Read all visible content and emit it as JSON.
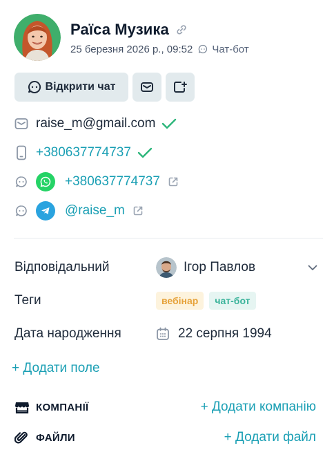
{
  "contact": {
    "name": "Раїса Музика",
    "created_at": "25 березня 2026 р., 09:52",
    "source": "Чат-бот"
  },
  "actions": {
    "open_chat_label": "Відкрити чат"
  },
  "contacts": {
    "email": "raise_m@gmail.com",
    "phone": "+380637774737",
    "whatsapp": "+380637774737",
    "telegram": "@raise_m"
  },
  "fields": {
    "responsible_label": "Відповідальний",
    "responsible_value": "Ігор Павлов",
    "tags_label": "Теги",
    "tags": [
      "вебінар",
      "чат-бот"
    ],
    "birthday_label": "Дата народження",
    "birthday_value": "22 серпня 1994"
  },
  "add_field_label": "+ Додати поле",
  "sections": {
    "companies_title": "КОМПАНІЇ",
    "companies_add": "+ Додати компанію",
    "files_title": "ФАЙЛИ",
    "files_add": "+ Додати файл"
  },
  "colors": {
    "accent": "#1a9fb4",
    "check": "#2bb57a",
    "button_bg": "#e2eaed",
    "whatsapp": "#25d366",
    "telegram": "#2aa3df",
    "tag_1_bg": "#fdf3dd",
    "tag_1_fg": "#e6a23a",
    "tag_2_bg": "#e6f5f2",
    "tag_2_fg": "#3ab39a"
  },
  "icons": {
    "header_link": "link-icon",
    "source": "chat-bubble-icon",
    "email": "mail-icon",
    "phone": "phone-icon",
    "messenger": "chat-bubble-icon",
    "external": "external-link-icon",
    "birthday": "calendar-icon",
    "companies": "store-icon",
    "files": "paperclip-icon"
  }
}
